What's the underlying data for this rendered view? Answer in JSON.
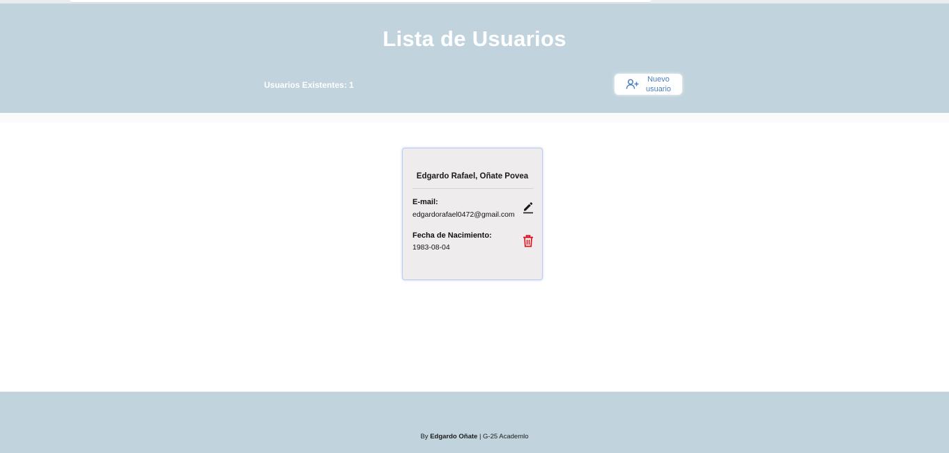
{
  "header": {
    "title": "Lista de Usuarios",
    "user_count_label": "Usuarios Existentes: 1",
    "new_user_button": {
      "label_line1": "Nuevo",
      "label_line2": "usuario",
      "icon": "user-plus-icon"
    }
  },
  "users": [
    {
      "name": "Edgardo Rafael, Oñate Povea",
      "email_label": "E-mail:",
      "email": "edgardorafael0472@gmail.com",
      "birth_label": "Fecha de Nacimiento:",
      "birth_date": "1983-08-04",
      "edit_icon": "pencil-icon",
      "delete_icon": "trash-icon"
    }
  ],
  "footer": {
    "prefix": "By",
    "author": "Edgardo Oñate",
    "suffix": "| G-25 Academlo"
  },
  "colors": {
    "header_bg": "#c1d4dd",
    "accent_blue": "#4a7fc1",
    "delete_red": "#d9141f",
    "card_bg": "#efeced"
  }
}
